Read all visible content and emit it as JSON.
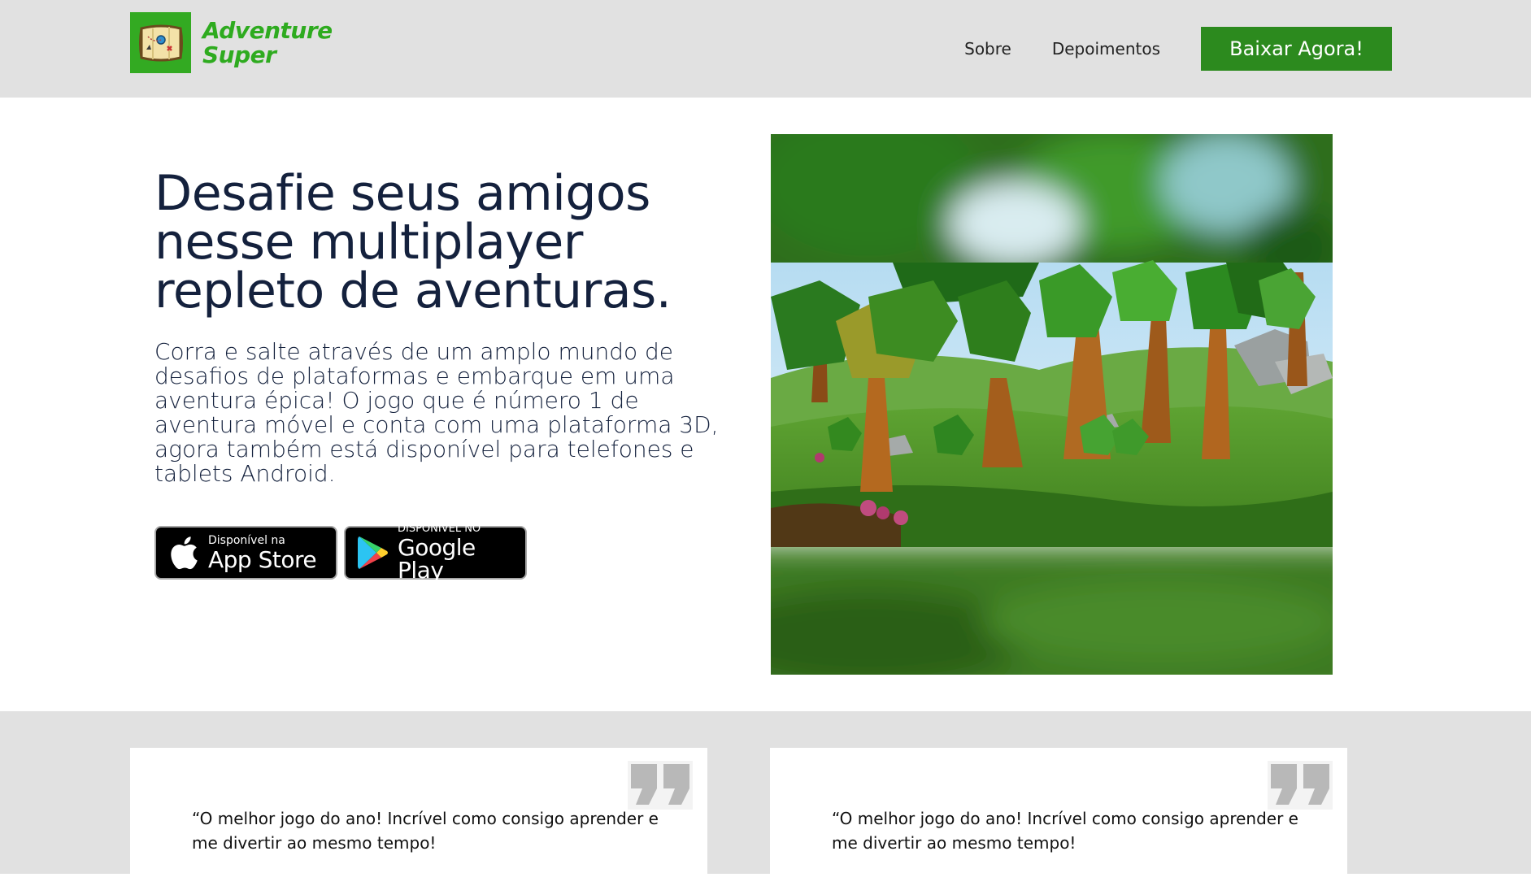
{
  "header": {
    "logo_line1": "Adventure",
    "logo_line2": "Super",
    "nav_items": [
      {
        "label": "Sobre"
      },
      {
        "label": "Depoimentos"
      }
    ],
    "cta_label": "Baixar Agora!"
  },
  "hero": {
    "title": "Desafie seus amigos nesse multiplayer repleto de aventuras.",
    "description": "Corra e salte através de um amplo mundo de desafios de plataformas e embarque em uma aventura épica! O jogo que é número 1 de aventura móvel e conta com uma plataforma 3D, agora também está disponível para telefones e tablets Android.",
    "badges": {
      "appstore": {
        "small": "Disponível na",
        "large": "App Store"
      },
      "googleplay": {
        "small": "DISPONÍVEL NO",
        "large": "Google Play"
      }
    }
  },
  "testimonials": [
    {
      "text": "“O melhor jogo do ano! Incrível como consigo aprender e me divertir ao mesmo tempo!"
    },
    {
      "text": "“O melhor jogo do ano! Incrível como consigo aprender e me divertir ao mesmo tempo!"
    }
  ],
  "colors": {
    "brand_green": "#2eab1f",
    "cta_green": "#2c8a1e",
    "header_bg": "#e1e1e1",
    "text_dark": "#14213d"
  },
  "icons": {
    "logo": "treasure-map-icon",
    "appstore": "apple-icon",
    "googleplay": "google-play-icon",
    "quote": "quote-icon"
  }
}
